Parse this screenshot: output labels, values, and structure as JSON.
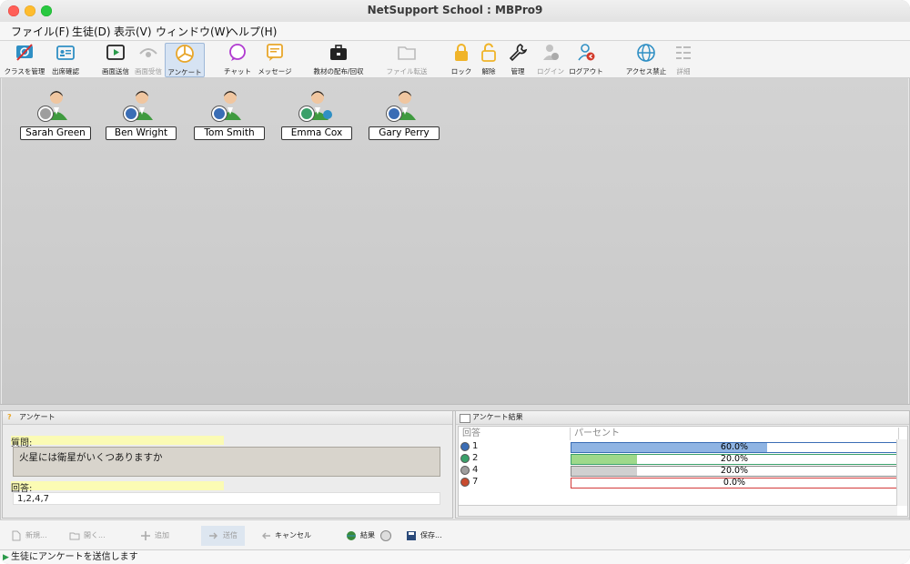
{
  "window": {
    "title": "NetSupport School : MBPro9"
  },
  "menu": [
    "ファイル(F)",
    "生徒(D)",
    "表示(V)",
    "ウィンドウ(W)",
    "ヘルプ(H)"
  ],
  "toolbar": [
    {
      "label": "クラスを管理",
      "icon": "class-manage-icon"
    },
    {
      "label": "出席確認",
      "icon": "attendance-icon"
    },
    {
      "label": "画面送信",
      "icon": "show-screen-icon"
    },
    {
      "label": "画面受信",
      "icon": "view-icon"
    },
    {
      "label": "アンケート",
      "icon": "survey-icon"
    },
    {
      "label": "チャット",
      "icon": "chat-icon"
    },
    {
      "label": "メッセージ",
      "icon": "message-icon"
    },
    {
      "label": "教材の配布/回収",
      "icon": "briefcase-icon"
    },
    {
      "label": "ファイル転送",
      "icon": "folder-icon"
    },
    {
      "label": "ロック",
      "icon": "lock-icon"
    },
    {
      "label": "解除",
      "icon": "unlock-icon"
    },
    {
      "label": "管理",
      "icon": "wrench-icon"
    },
    {
      "label": "ログイン",
      "icon": "login-icon"
    },
    {
      "label": "ログアウト",
      "icon": "logout-icon"
    },
    {
      "label": "アクセス禁止",
      "icon": "globe-icon"
    },
    {
      "label": "詳細",
      "icon": "details-icon"
    }
  ],
  "students": [
    {
      "name": "Sarah Green",
      "dot_color": "#9e9e9e"
    },
    {
      "name": "Ben Wright",
      "dot_color": "#3a6db5"
    },
    {
      "name": "Tom Smith",
      "dot_color": "#3a6db5"
    },
    {
      "name": "Emma Cox",
      "dot_color": "#3aa06a"
    },
    {
      "name": "Gary Perry",
      "dot_color": "#3a6db5"
    }
  ],
  "survey_panel": {
    "title": "アンケート",
    "question_label": "質問:",
    "question": "火星には衛星がいくつありますか",
    "answer_label": "回答:",
    "answers": "1,2,4,7"
  },
  "results_panel": {
    "title": "アンケート結果",
    "col_answer": "回答",
    "col_percent": "パーセント",
    "rows": [
      {
        "answer": "1",
        "percent": "60.0%",
        "fraction": 0.6,
        "dot_color": "#3a6db5",
        "bar_color": "#8fb4e3",
        "border": "#3a6db5"
      },
      {
        "answer": "2",
        "percent": "20.0%",
        "fraction": 0.2,
        "dot_color": "#3aa06a",
        "bar_color": "#9ed98a",
        "border": "#3aa06a"
      },
      {
        "answer": "4",
        "percent": "20.0%",
        "fraction": 0.2,
        "dot_color": "#9e9e9e",
        "bar_color": "#d0d0d0",
        "border": "#888888"
      },
      {
        "answer": "7",
        "percent": "0.0%",
        "fraction": 0.0,
        "dot_color": "#c84b2f",
        "bar_color": "#f3c0b4",
        "border": "#d33a3a"
      }
    ]
  },
  "bottom_toolbar": {
    "new": "新規...",
    "open": "開く...",
    "add": "追加",
    "send": "送信",
    "cancel": "キャンセル",
    "result": "結果",
    "save": "保存..."
  },
  "status": "生徒にアンケートを送信します"
}
